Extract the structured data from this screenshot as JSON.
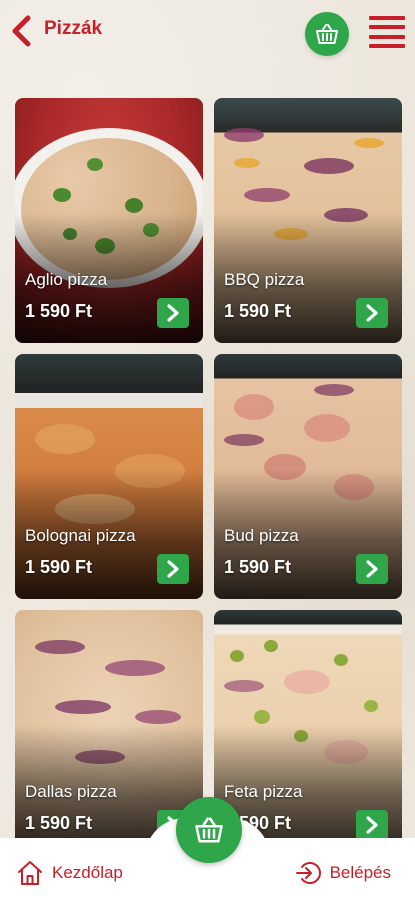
{
  "header": {
    "title": "Pizzák"
  },
  "products": [
    {
      "name": "Aglio pizza",
      "price": "1 590 Ft"
    },
    {
      "name": "BBQ pizza",
      "price": "1 590 Ft"
    },
    {
      "name": "Bolognai pizza",
      "price": "1 590 Ft"
    },
    {
      "name": "Bud pizza",
      "price": "1 590 Ft"
    },
    {
      "name": "Dallas pizza",
      "price": "1 590 Ft"
    },
    {
      "name": "Feta pizza",
      "price": "1 590 Ft"
    }
  ],
  "bottom_nav": {
    "home_label": "Kezdőlap",
    "login_label": "Belépés"
  },
  "colors": {
    "accent_red": "#c6202a",
    "accent_green": "#2fa64a"
  },
  "icons": {
    "back": "chevron-left-icon",
    "cart": "basket-icon",
    "menu": "hamburger-menu-icon",
    "home": "home-icon",
    "login": "login-arrow-icon",
    "card_action": "chevron-right-icon"
  }
}
